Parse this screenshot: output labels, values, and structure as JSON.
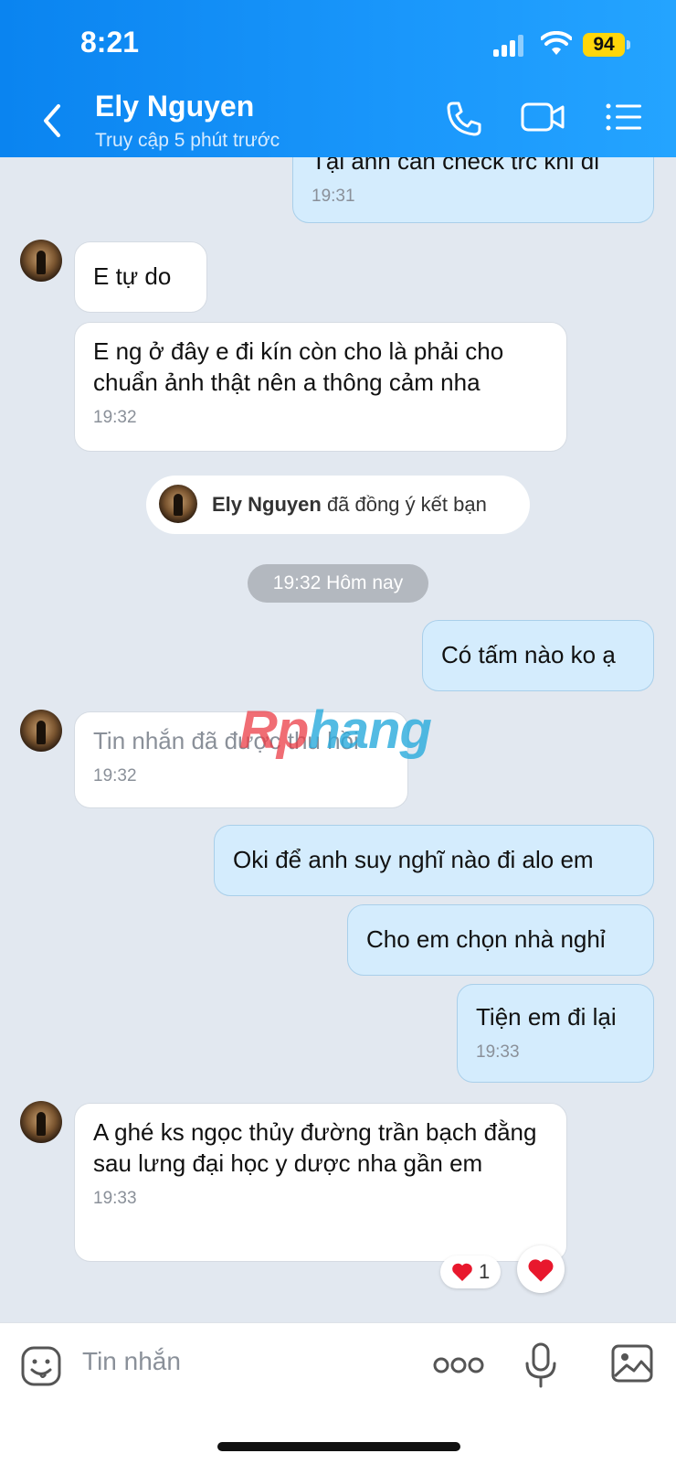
{
  "status_bar": {
    "time": "8:21",
    "battery": "94"
  },
  "header": {
    "contact_name": "Ely Nguyen",
    "contact_status": "Truy cập 5 phút trước"
  },
  "messages": [
    {
      "text": "Tại anh cần check trc khi đi",
      "time": "19:31"
    },
    {
      "text": "E tự do"
    },
    {
      "text": "E ng ở đây e đi kín còn cho là phải cho chuẩn ảnh thật nên a thông cảm nha",
      "time": "19:32"
    },
    {
      "text": "Có tấm nào ko ạ"
    },
    {
      "text": "Tin nhắn đã được thu hồi",
      "time": "19:32"
    },
    {
      "text": "Oki để anh suy nghĩ nào đi alo em"
    },
    {
      "text": "Cho em chọn nhà nghỉ"
    },
    {
      "text": "Tiện em đi lại",
      "time": "19:33"
    },
    {
      "text": "A ghé ks ngọc thủy đường trần bạch đằng sau lưng đại học y dược nha gần em",
      "time": "19:33",
      "reaction_count": "1"
    }
  ],
  "system_notice": {
    "name": "Ely Nguyen",
    "text": "đã đồng ý kết bạn"
  },
  "date_divider": "19:32 Hôm nay",
  "watermark": {
    "part1": "Rp",
    "part2": "hang"
  },
  "composer": {
    "placeholder": "Tin nhắn"
  },
  "colors": {
    "header_blue": "#0a84f0",
    "outgoing_bubble": "#d4ecfd",
    "incoming_bubble": "#ffffff",
    "background": "#e2e8f0"
  },
  "icons": [
    "back-icon",
    "phone-icon",
    "video-call-icon",
    "menu-list-icon",
    "sticker-icon",
    "more-options-icon",
    "microphone-icon",
    "image-icon",
    "heart-icon"
  ]
}
